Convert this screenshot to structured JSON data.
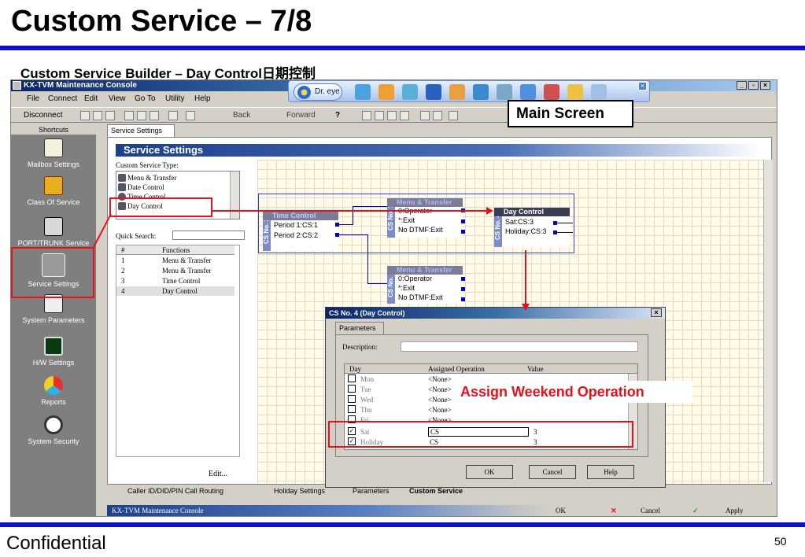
{
  "slide": {
    "title": "Custom Service – 7/8",
    "subtitle": "Custom Service Builder – Day Control日期控制",
    "footer_left": "Confidential",
    "page_number": "50"
  },
  "window": {
    "title": "KX-TVM Maintenance Console",
    "controls": [
      "_",
      "ș",
      "×"
    ]
  },
  "menu": [
    "File",
    "Connect",
    "Edit",
    "View",
    "Go To",
    "Utility",
    "Help"
  ],
  "toolbar": {
    "disconnect": "Disconnect",
    "back": "Back",
    "forward": "Forward",
    "help": "?"
  },
  "dreye": {
    "label": "Dr. eye",
    "close": "×"
  },
  "callouts": {
    "main_screen": "Main Screen",
    "assign_weekend": "Assign Weekend Operation"
  },
  "sidebar": {
    "header": "Shortcuts",
    "items": [
      {
        "label": "Mailbox Settings",
        "icon": "mailbox-icon"
      },
      {
        "label": "Class Of Service",
        "icon": "class-of-service-icon"
      },
      {
        "label": "PORT/TRUNK Service",
        "icon": "port-trunk-icon"
      },
      {
        "label": "Service Settings",
        "icon": "wrench-icon"
      },
      {
        "label": "System Parameters",
        "icon": "system-parameters-icon"
      },
      {
        "label": "H/W Settings",
        "icon": "hardware-icon"
      },
      {
        "label": "Reports",
        "icon": "reports-icon"
      },
      {
        "label": "System Security",
        "icon": "security-icon"
      }
    ]
  },
  "tab_top": "Service Settings",
  "panel": {
    "header": "Service Settings",
    "type_label": "Custom Service Type:",
    "types": [
      "Menu & Transfer",
      "Date Control",
      "Time Control",
      "Day Control"
    ],
    "quick_search_label": "Quick Search:",
    "func_headers": [
      "#",
      "Functions"
    ],
    "functions": [
      {
        "num": "1",
        "name": "Menu & Transfer"
      },
      {
        "num": "2",
        "name": "Menu & Transfer"
      },
      {
        "num": "3",
        "name": "Time Control"
      },
      {
        "num": "4",
        "name": "Day Control"
      }
    ],
    "edit_button": "Edit..."
  },
  "nodes": {
    "cs1": {
      "side": "CS No. 1",
      "title": "Menu & Transfer",
      "lines": [
        "0:Operator",
        "*:Exit",
        "No DTMF:Exit"
      ]
    },
    "cs3": {
      "side": "CS No. 3",
      "title": "Time Control",
      "lines": [
        "Period 1:CS:1",
        "Period 2:CS:2"
      ]
    },
    "cs4": {
      "side": "CS No. 4",
      "title": "Day Control",
      "lines": [
        "Sat:CS:3",
        "Holiday:CS:3"
      ]
    },
    "cs2": {
      "side": "CS No. 2",
      "title": "Menu & Transfer",
      "lines": [
        "0:Operator",
        "*:Exit",
        "No DTMF:Exit"
      ]
    }
  },
  "dialog": {
    "title": "CS No. 4 (Day Control)",
    "close": "×",
    "tab": "Parameters",
    "description_label": "Description:",
    "columns": [
      "Day",
      "Assigned Operation",
      "Value"
    ],
    "rows": [
      {
        "day": "Mon",
        "op": "<None>",
        "value": "",
        "checked": false
      },
      {
        "day": "Tue",
        "op": "<None>",
        "value": "",
        "checked": false
      },
      {
        "day": "Wed",
        "op": "<None>",
        "value": "",
        "checked": false
      },
      {
        "day": "Thu",
        "op": "<None>",
        "value": "",
        "checked": false
      },
      {
        "day": "Fri",
        "op": "<None>",
        "value": "",
        "checked": false
      },
      {
        "day": "Sat",
        "op": "CS",
        "value": "3",
        "checked": true
      },
      {
        "day": "Holiday",
        "op": "CS",
        "value": "3",
        "checked": true
      }
    ],
    "ok": "OK",
    "cancel": "Cancel",
    "help": "Help"
  },
  "bottom_tabs": [
    "Caller ID/DID/PIN Call Routing",
    "Holiday Settings",
    "Parameters",
    "Custom Service"
  ],
  "status": {
    "left": "KX-TVM Maintenance Console",
    "ok": "OK",
    "cancel": "Cancel",
    "apply": "Apply"
  },
  "colors": {
    "accent_rule": "#1010c8",
    "highlight_red": "#e8101a",
    "wire_blue": "#0000c0"
  }
}
